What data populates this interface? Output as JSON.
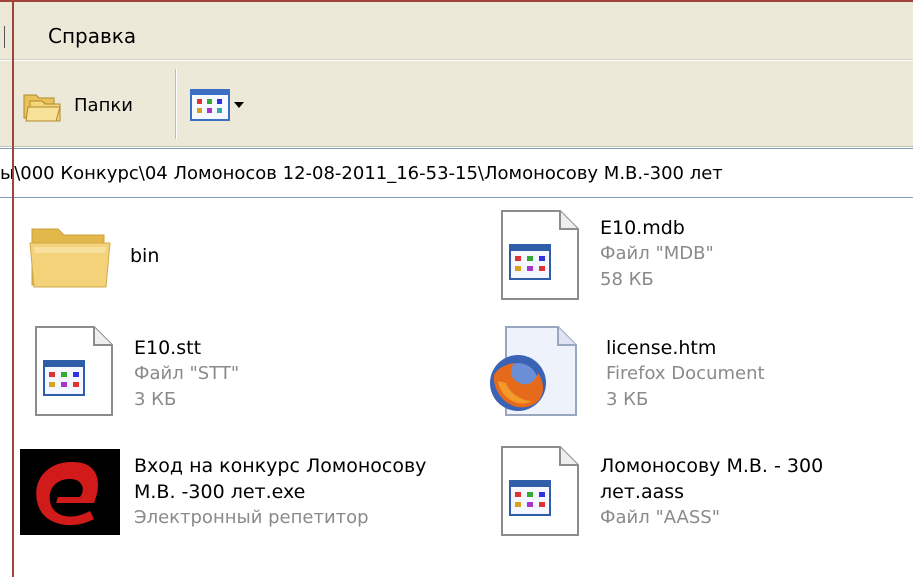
{
  "menubar": {
    "items": [
      "Справка"
    ]
  },
  "toolbar": {
    "folders_label": "Папки"
  },
  "address": {
    "path": "ы\\000  Конкурс\\04 Ломоносов 12-08-2011_16-53-15\\Ломоносову М.В.-300 лет"
  },
  "files": [
    {
      "name": "bin",
      "type": "",
      "size": "",
      "icon": "folder-icon"
    },
    {
      "name": "E10.mdb",
      "type": "Файл \"MDB\"",
      "size": "58 КБ",
      "icon": "application-file-icon"
    },
    {
      "name": "E10.stt",
      "type": "Файл \"STT\"",
      "size": "3 КБ",
      "icon": "application-file-icon"
    },
    {
      "name": "license.htm",
      "type": "Firefox Document",
      "size": "3 КБ",
      "icon": "firefox-document-icon"
    },
    {
      "name_line1": "Вход на конкурс  Ломоносову",
      "name_line2": "М.В. -300 лет.exe",
      "type": "Электронный репетитор",
      "icon": "repetitor-app-icon"
    },
    {
      "name_line1": "Ломоносову М.В. - 300",
      "name_line2": "лет.aass",
      "type": "Файл \"AASS\"",
      "icon": "application-file-icon"
    }
  ],
  "colors": {
    "toolbar_bg": "#ece9d8",
    "frame": "#a0433a",
    "secondary_text": "#8a8a8a"
  }
}
